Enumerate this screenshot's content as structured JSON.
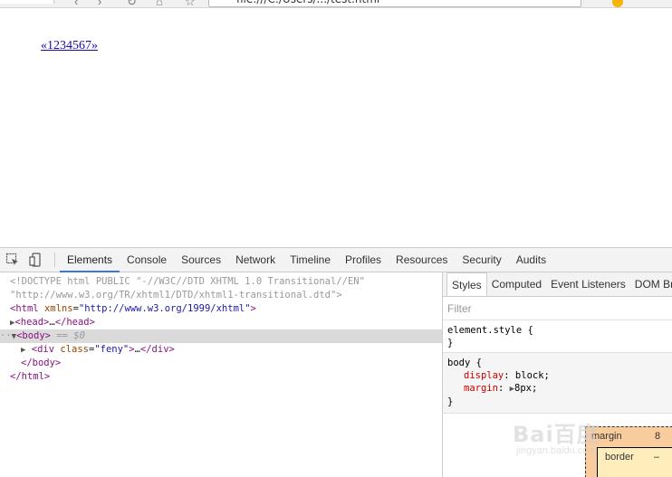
{
  "browser": {
    "address": "file:///C:/Users/.../test.html"
  },
  "page": {
    "link_text": "«1234567»"
  },
  "devtools": {
    "tabs": [
      "Elements",
      "Console",
      "Sources",
      "Network",
      "Timeline",
      "Profiles",
      "Resources",
      "Security",
      "Audits"
    ],
    "active_tab": "Elements",
    "dom": {
      "doctype_1": "<!DOCTYPE html PUBLIC \"-//W3C//DTD XHTML 1.0 Transitional//EN\"",
      "doctype_2": "\"http://www.w3.org/TR/xhtml1/DTD/xhtml1-transitional.dtd\">",
      "html_tag": "html",
      "html_attr": "xmlns",
      "html_val": "\"http://www.w3.org/1999/xhtml\"",
      "head_open": "<head>",
      "head_ellipsis": "…",
      "head_close": "</head>",
      "body_open": "<body>",
      "body_marker": " == $0",
      "div_tag": "div",
      "div_attr": "class",
      "div_val": "\"feny\"",
      "div_ellipsis": "…",
      "div_close": "</div>",
      "body_close": "</body>",
      "html_close": "</html>"
    },
    "styles": {
      "tabs": [
        "Styles",
        "Computed",
        "Event Listeners",
        "DOM Bre"
      ],
      "filter_placeholder": "Filter",
      "rule1_selector": "element.style {",
      "rule1_close": "}",
      "rule2_selector": "body {",
      "rule2_prop1_name": "display",
      "rule2_prop1_value": "block;",
      "rule2_prop2_name": "margin",
      "rule2_prop2_value": "8px;",
      "rule2_close": "}"
    },
    "box_model": {
      "margin_label": "margin",
      "margin_value": "8",
      "border_label": "border",
      "border_value": "–"
    }
  },
  "watermark": {
    "text": "Bai百度",
    "sub": "jingyan.baidu.com"
  }
}
